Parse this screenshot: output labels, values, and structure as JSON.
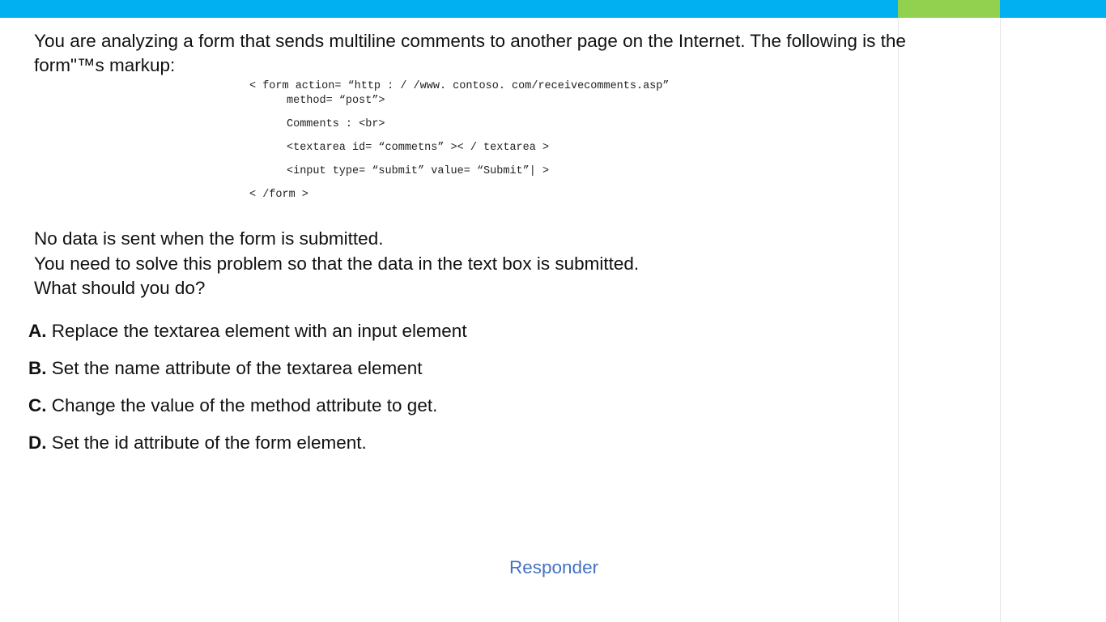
{
  "colors": {
    "top_bar": "#00b0f0",
    "top_bar_accent": "#92d050",
    "link": "#4472c4"
  },
  "question": {
    "line1": "You are analyzing a form that sends multiline comments to another page on the Internet. The following is the",
    "line2": "form\"™s markup:"
  },
  "code": {
    "lines": [
      "< form action= “http : / /www. contoso. com/receivecomments.asp”",
      "method= “post”>",
      "Comments : <br>",
      "<textarea id= “commetns” >< / textarea >",
      "<input type= “submit” value= “Submit”| >",
      "< /form >"
    ]
  },
  "info": {
    "line1": "No data is sent when the form is submitted.",
    "line2": "You need to solve this problem so that the data in the text box is submitted.",
    "line3": "What should you do?"
  },
  "options": [
    {
      "letter": "A.",
      "text": "Replace the textarea element with an input element"
    },
    {
      "letter": "B.",
      "text": "Set the name attribute of the textarea element"
    },
    {
      "letter": "C.",
      "text": "Change the value of the method attribute to get."
    },
    {
      "letter": "D.",
      "text": "Set the id attribute of the form element."
    }
  ],
  "responder": {
    "label": "Responder"
  }
}
